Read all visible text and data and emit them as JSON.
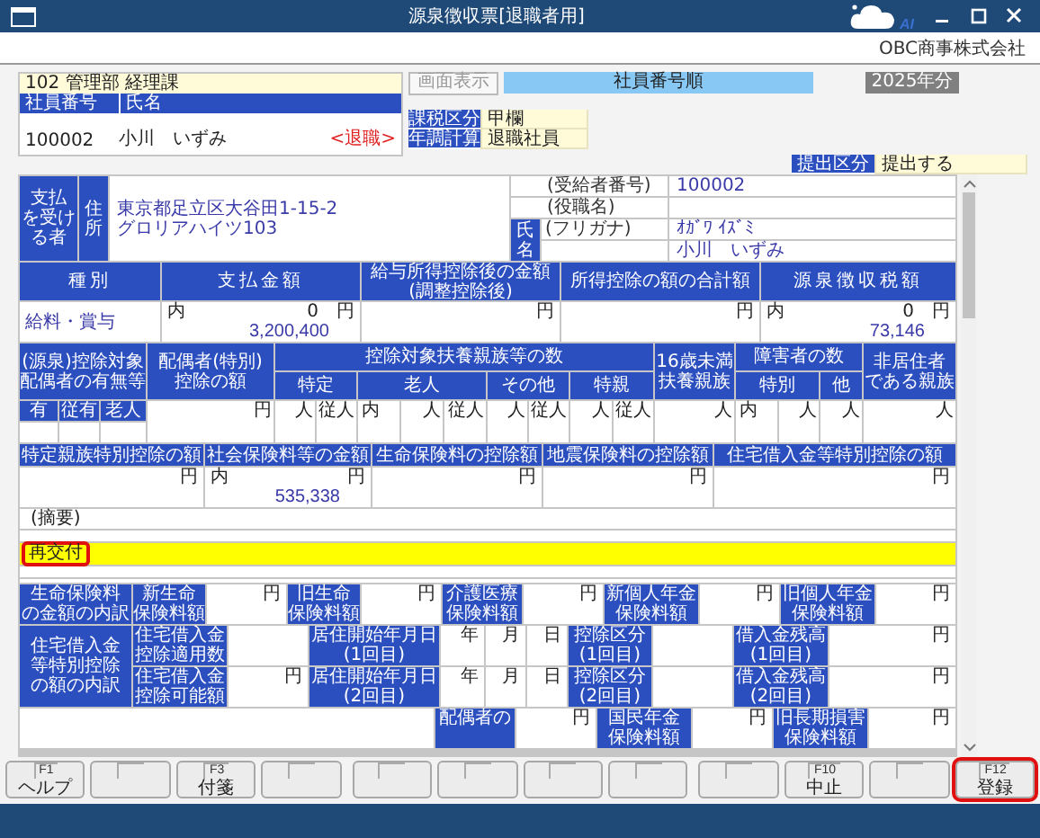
{
  "window": {
    "title": "源泉徴収票[退職者用]",
    "ai_badge": "AI",
    "company": "OBC商事株式会社"
  },
  "employee": {
    "department": "102 管理部 経理課",
    "columns": [
      "社員番号",
      "氏名"
    ],
    "number": "100002",
    "name": "小川　いずみ",
    "status": "<退職>"
  },
  "view_button": {
    "label": "画面表示",
    "disabled": true
  },
  "sort_order": "社員番号順",
  "year": "2025年分",
  "tax_info": [
    {
      "label": "課税区分",
      "value": "甲欄"
    },
    {
      "label": "年調計算",
      "value": "退職社員"
    }
  ],
  "submission": {
    "label": "提出区分",
    "value": "提出する"
  },
  "recipient": {
    "side_label_lines": [
      "支払",
      "を受け",
      "る者"
    ],
    "address_label": "住所",
    "address_lines": [
      "東京都足立区大谷田1-15-2",
      "グロリアハイツ103"
    ],
    "name_label": "氏名",
    "fields": [
      {
        "label": "(受給者番号)",
        "value": "100002"
      },
      {
        "label": "(役職名)"
      },
      {
        "label": "(フリガナ)",
        "value": "ｵｶﾞﾜ ｲｽﾞﾐ"
      },
      {
        "value": "小川　いずみ"
      }
    ]
  },
  "income": {
    "columns": [
      {
        "lines": [
          "種別"
        ]
      },
      {
        "lines": [
          "支払金額"
        ]
      },
      {
        "lines": [
          "給与所得控除後の金額",
          "(調整控除後)"
        ]
      },
      {
        "lines": [
          "所得控除の額の合計額"
        ]
      },
      {
        "lines": [
          "源泉徴収税額"
        ]
      }
    ],
    "row": {
      "type": "給料・賞与",
      "cells": [
        {
          "prefix": "内",
          "small": "0",
          "unit": "円",
          "amount": "3,200,400"
        },
        {
          "unit": "円"
        },
        {
          "unit": "円"
        },
        {
          "prefix": "内",
          "small": "0",
          "unit": "円",
          "amount": "73,146"
        }
      ]
    }
  },
  "family": {
    "spouse_presence": "(源泉)控除対象配偶者の有無等",
    "spouse_options": [
      "有",
      "従有",
      "老人"
    ],
    "spouse_deduction": [
      "配偶者(特別)",
      "控除の額"
    ],
    "dependents": "控除対象扶養親族等の数",
    "dependent_groups": [
      "特定",
      "老人",
      "その他",
      "特親"
    ],
    "under16": [
      "16歳未満",
      "扶養親族"
    ],
    "disabled": "障害者の数",
    "disabled_groups": [
      "特別",
      "他"
    ],
    "nonresident": [
      "非居住者",
      "である親族"
    ],
    "cells": [
      {
        "kind": "unit",
        "text": "円"
      },
      {
        "kind": "unit",
        "text": "人"
      },
      {
        "kind": "unit",
        "text": "従人"
      },
      {
        "kind": "prefix",
        "text": "内"
      },
      {
        "kind": "unit",
        "text": "人"
      },
      {
        "kind": "unit",
        "text": "従人"
      },
      {
        "kind": "unit",
        "text": "人"
      },
      {
        "kind": "unit",
        "text": "従人"
      },
      {
        "kind": "unit",
        "text": "人"
      },
      {
        "kind": "unit",
        "text": "従人"
      },
      {
        "kind": "unit",
        "text": "人"
      },
      {
        "kind": "prefix",
        "text": "内"
      },
      {
        "kind": "unit",
        "text": "人"
      },
      {
        "kind": "unit",
        "text": "人"
      },
      {
        "kind": "unit",
        "text": "人"
      }
    ]
  },
  "deductions": {
    "columns": [
      "特定親族特別控除の額",
      "社会保険料等の金額",
      "生命保険料の控除額",
      "地震保険料の控除額",
      "住宅借入金等特別控除の額"
    ],
    "cells": [
      {
        "unit": "円"
      },
      {
        "prefix": "内",
        "unit": "円",
        "amount": "535,338"
      },
      {
        "unit": "円"
      },
      {
        "unit": "円"
      },
      {
        "unit": "円"
      }
    ]
  },
  "remarks": {
    "label": "(摘要)",
    "lines": [
      {
        "text": "再交付",
        "highlighted": true,
        "callout": true
      }
    ]
  },
  "life_insurance": {
    "label": [
      "生命保険料",
      "の金額の内訳"
    ],
    "items": [
      {
        "label": [
          "新生命",
          "保険料額"
        ],
        "unit": "円"
      },
      {
        "label": [
          "旧生命",
          "保険料額"
        ],
        "unit": "円"
      },
      {
        "label": [
          "介護医療",
          "保険料額"
        ],
        "unit": "円"
      },
      {
        "label": [
          "新個人年金",
          "保険料額"
        ],
        "unit": "円"
      },
      {
        "label": [
          "旧個人年金",
          "保険料額"
        ],
        "unit": "円"
      }
    ]
  },
  "housing_loan": {
    "label": [
      "住宅借入金",
      "等特別控除",
      "の額の内訳"
    ],
    "rows": [
      {
        "label": [
          "住宅借入金",
          "控除適用数"
        ],
        "start_label": [
          "居住開始年月日",
          "(1回目)"
        ],
        "date_units": [
          "年",
          "月",
          "日"
        ],
        "category_label": [
          "控除区分",
          "(1回目)"
        ],
        "balance_label": [
          "借入金残高",
          "(1回目)"
        ],
        "balance_unit": "円"
      },
      {
        "label": [
          "住宅借入金",
          "控除可能額"
        ],
        "unit": "円",
        "start_label": [
          "居住開始年月日",
          "(2回目)"
        ],
        "date_units": [
          "年",
          "月",
          "日"
        ],
        "category_label": [
          "控除区分",
          "(2回目)"
        ],
        "balance_label": [
          "借入金残高",
          "(2回目)"
        ],
        "balance_unit": "円"
      }
    ]
  },
  "other_insurance": {
    "items": [
      {
        "label": [
          "配偶者の"
        ],
        "unit": "円"
      },
      {
        "label": [
          "国民年金",
          "保険料額"
        ],
        "unit": "円"
      },
      {
        "label": [
          "旧長期損害",
          "保険料額"
        ],
        "unit": "円"
      }
    ]
  },
  "function_keys": [
    {
      "kind": "key",
      "key": "F1",
      "label": "ヘルプ",
      "callout": false
    },
    {
      "kind": "blank"
    },
    {
      "kind": "key",
      "key": "F3",
      "label": "付箋",
      "callout": false
    },
    {
      "kind": "blank"
    },
    {
      "kind": "blank"
    },
    {
      "kind": "blank"
    },
    {
      "kind": "blank"
    },
    {
      "kind": "blank"
    },
    {
      "kind": "blank"
    },
    {
      "kind": "key",
      "key": "F10",
      "label": "中止",
      "callout": false
    },
    {
      "kind": "blank"
    },
    {
      "kind": "key",
      "key": "F12",
      "label": "登録",
      "callout": true
    }
  ]
}
